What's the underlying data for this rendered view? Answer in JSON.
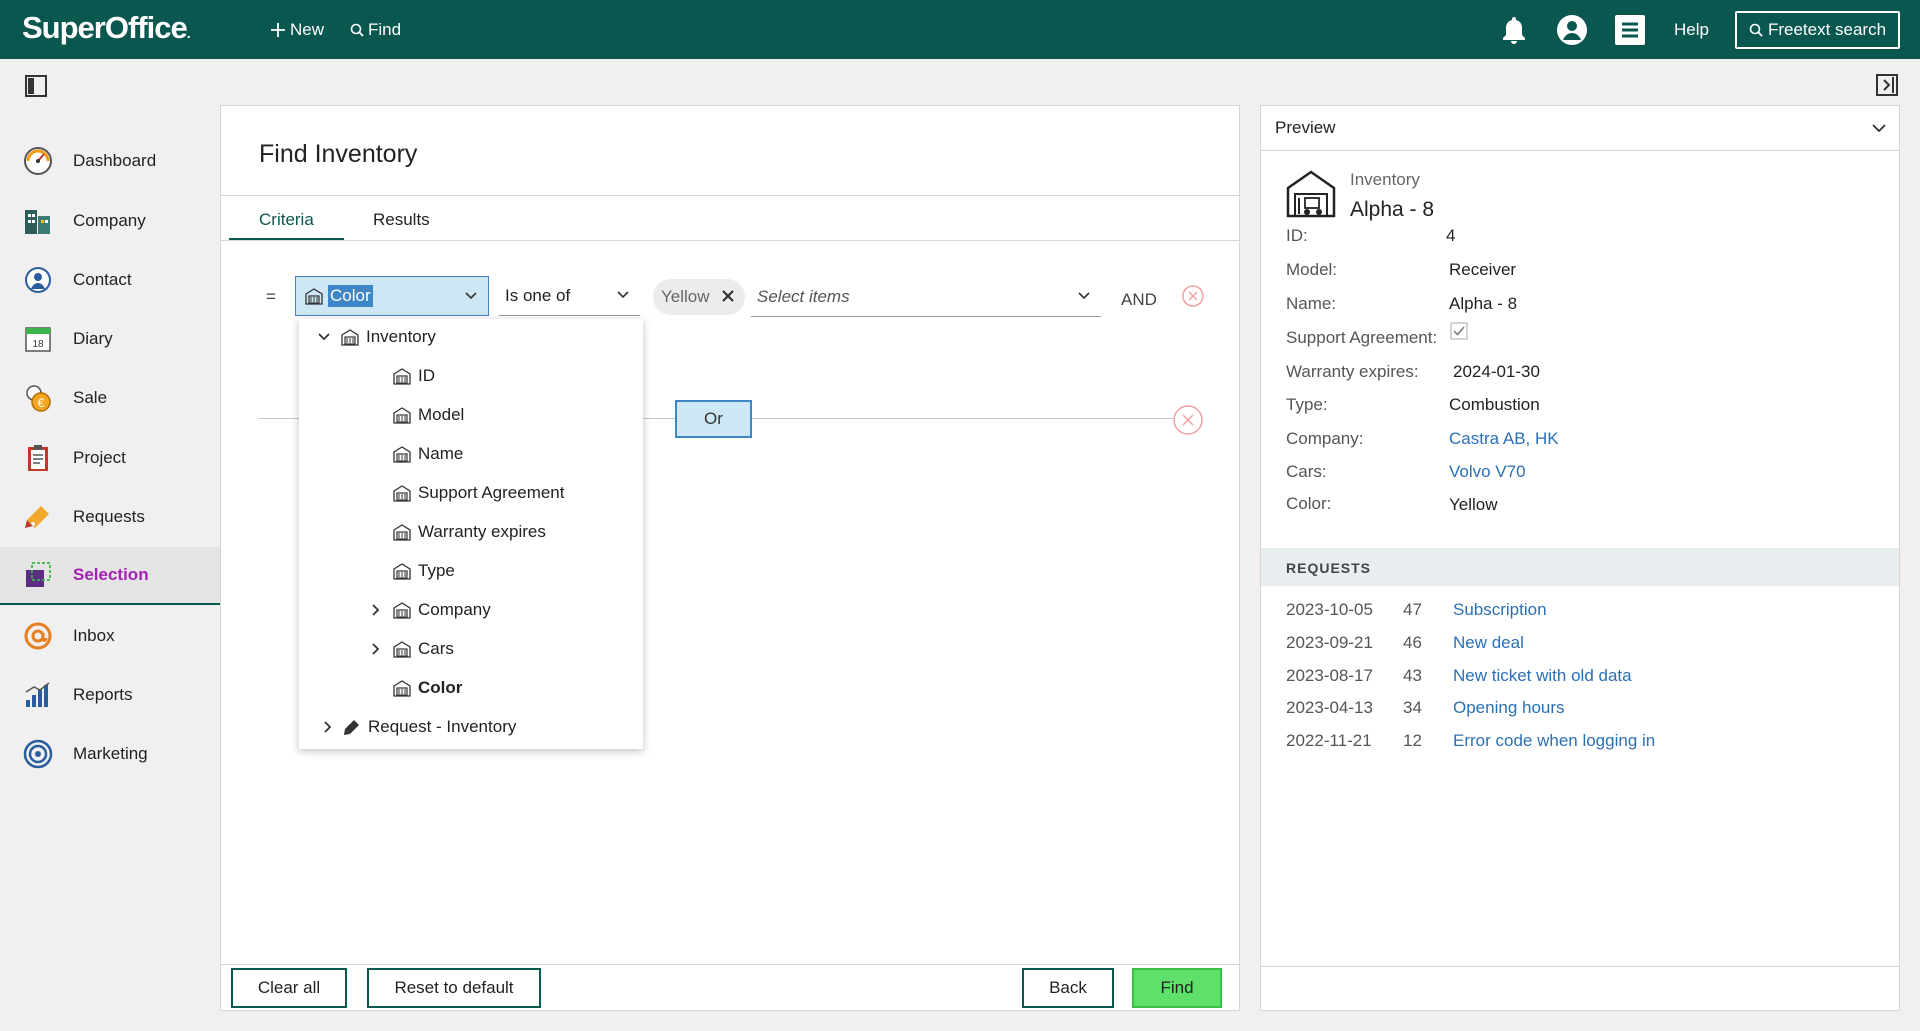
{
  "app": {
    "logo": "SuperOffice",
    "logo_dot": "."
  },
  "topbar": {
    "new_label": "New",
    "find_label": "Find",
    "help_label": "Help",
    "freetext_label": "Freetext search",
    "icons": [
      "bell-icon",
      "user-icon",
      "menu-icon"
    ]
  },
  "sidebar": {
    "items": [
      {
        "label": "Dashboard",
        "icon": "speedometer-icon"
      },
      {
        "label": "Company",
        "icon": "buildings-icon"
      },
      {
        "label": "Contact",
        "icon": "person-icon"
      },
      {
        "label": "Diary",
        "icon": "calendar-icon",
        "badge": "18"
      },
      {
        "label": "Sale",
        "icon": "coins-icon"
      },
      {
        "label": "Project",
        "icon": "clipboard-icon"
      },
      {
        "label": "Requests",
        "icon": "ticket-icon"
      },
      {
        "label": "Selection",
        "icon": "selection-icon",
        "active": true
      },
      {
        "label": "Inbox",
        "icon": "at-icon"
      },
      {
        "label": "Reports",
        "icon": "bar-chart-icon"
      },
      {
        "label": "Marketing",
        "icon": "target-icon"
      }
    ]
  },
  "main": {
    "title": "Find Inventory",
    "tabs": [
      {
        "label": "Criteria",
        "active": true
      },
      {
        "label": "Results"
      }
    ],
    "criteria": {
      "eq": "=",
      "field": "Color",
      "operator": "Is one of",
      "chip": "Yellow",
      "items_placeholder": "Select items",
      "conjunction": "AND",
      "or_label": "Or"
    },
    "tree": {
      "root": "Inventory",
      "children": [
        "ID",
        "Model",
        "Name",
        "Support Agreement",
        "Warranty expires",
        "Type",
        "Company",
        "Cars",
        "Color"
      ],
      "expandable": [
        "Company",
        "Cars"
      ],
      "selected": "Color",
      "sibling": "Request - Inventory"
    },
    "buttons": {
      "clear_all": "Clear all",
      "reset": "Reset to default",
      "back": "Back",
      "find": "Find"
    }
  },
  "preview": {
    "header": "Preview",
    "entity_type": "Inventory",
    "entity_name": "Alpha - 8",
    "fields": [
      {
        "label": "ID:",
        "value": "4"
      },
      {
        "label": "Model:",
        "value": "Receiver"
      },
      {
        "label": "Name:",
        "value": "Alpha - 8"
      },
      {
        "label": "Support Agreement:",
        "value": "",
        "checkbox": true
      },
      {
        "label": "Warranty expires:",
        "value": "2024-01-30"
      },
      {
        "label": "Type:",
        "value": "Combustion"
      },
      {
        "label": "Company:",
        "value": "Castra AB, HK",
        "link": true
      },
      {
        "label": "Cars:",
        "value": "Volvo V70",
        "link": true
      },
      {
        "label": "Color:",
        "value": "Yellow"
      }
    ],
    "requests_header": "REQUESTS",
    "requests": [
      {
        "date": "2023-10-05",
        "id": "47",
        "title": "Subscription"
      },
      {
        "date": "2023-09-21",
        "id": "46",
        "title": "New deal"
      },
      {
        "date": "2023-08-17",
        "id": "43",
        "title": "New ticket with old data"
      },
      {
        "date": "2023-04-13",
        "id": "34",
        "title": "Opening hours"
      },
      {
        "date": "2022-11-21",
        "id": "12",
        "title": "Error code when logging in"
      }
    ]
  },
  "colors": {
    "brand": "#0a5750",
    "accent": "#a421b4",
    "link": "#2b6fb5",
    "find": "#5ee06b"
  }
}
